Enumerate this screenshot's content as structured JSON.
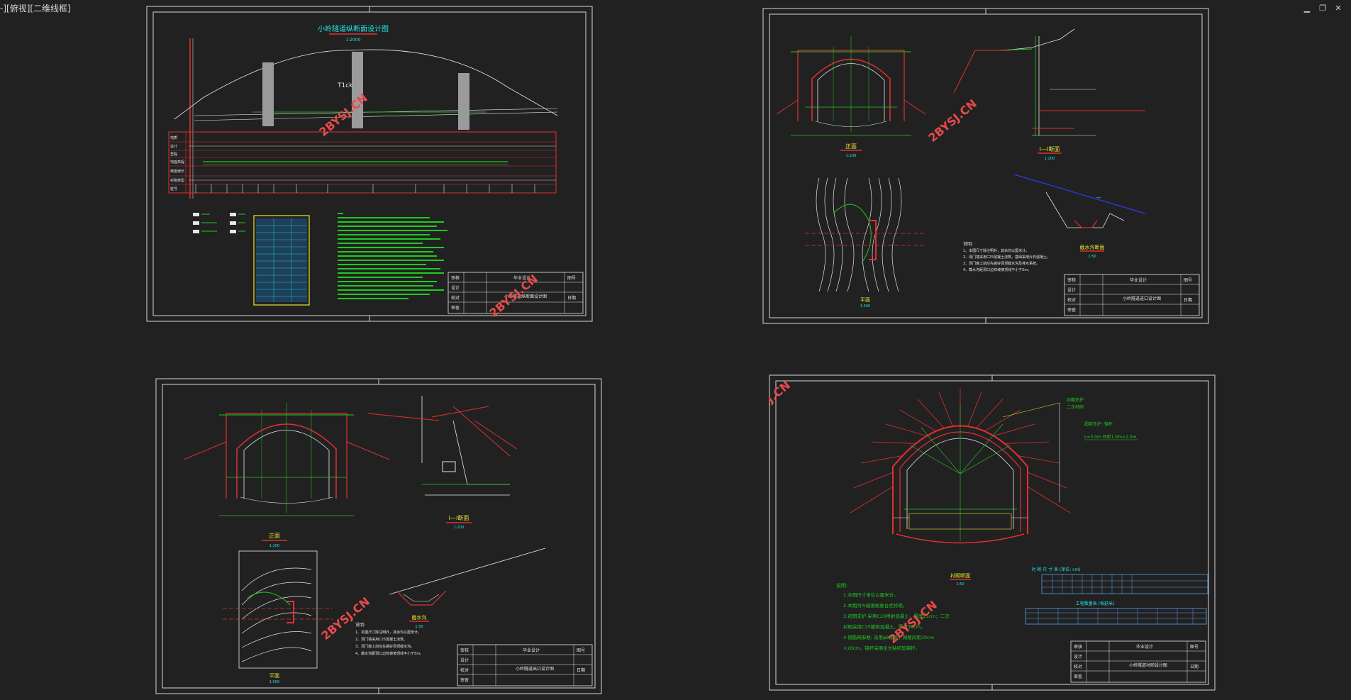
{
  "viewport_label": "-][俯视][二维线框]",
  "window_controls": {
    "minimize": "▁",
    "restore": "❐",
    "close": "✕"
  },
  "watermark": "2BYSJ.CN",
  "sheets": {
    "profile": {
      "title": "小岭隧道纵断面设计图",
      "scale": "1:2000",
      "mark": "T1ck",
      "row_labels": [
        "地质",
        "设计",
        "里程",
        "地面高程",
        "坡度坡长",
        "衬砌类型",
        "桩号"
      ],
      "title_block": {
        "rows": [
          [
            "审核",
            "",
            "",
            "图号"
          ],
          [
            "设计",
            "",
            "",
            ""
          ],
          [
            "校对",
            "",
            "",
            "日期"
          ],
          [
            "审查",
            "",
            "",
            ""
          ]
        ],
        "project": "毕业设计",
        "drawing": "小岭隧道纵断面设计图"
      }
    },
    "portal_in": {
      "view1": "正面",
      "view1_scale": "1:200",
      "view2": "Ⅰ—Ⅰ断面",
      "view2_scale": "1:200",
      "view3": "平面",
      "view3_scale": "1:500",
      "view4": "截水沟断面",
      "view4_scale": "1:50",
      "notes_title": "说明:",
      "notes": [
        "1、本图尺寸除注明外，其余均以厘米计。",
        "2、洞门墙采用C25混凝土浇筑，基础采用片石混凝土。",
        "3、洞门施工前应先做好洞顶截水沟及排水系统。",
        "4、截水沟距洞口边仰坡坡顶线不小于5m。"
      ],
      "title_block": {
        "rows": [
          [
            "审核",
            "",
            "",
            "图号"
          ],
          [
            "设计",
            "",
            "",
            ""
          ],
          [
            "校对",
            "",
            "",
            "日期"
          ],
          [
            "审查",
            "",
            "",
            ""
          ]
        ],
        "project": "毕业设计",
        "drawing": "小岭隧道进口设计图"
      }
    },
    "portal_out": {
      "view1": "正面",
      "view1_scale": "1:200",
      "view2": "Ⅰ—Ⅰ断面",
      "view2_scale": "1:200",
      "view3": "平面",
      "view3_scale": "1:500",
      "view4": "截水沟",
      "view4_scale": "1:50",
      "notes_title": "说明:",
      "notes": [
        "1、本图尺寸除注明外，其余均以厘米计。",
        "2、洞门墙采用C25混凝土浇筑。",
        "3、洞门施工前应先做好洞顶截水沟。",
        "4、截水沟距洞口边仰坡坡顶线不小于5m。"
      ],
      "title_block": {
        "rows": [
          [
            "审核",
            "",
            "",
            "图号"
          ],
          [
            "设计",
            "",
            "",
            ""
          ],
          [
            "校对",
            "",
            "",
            "日期"
          ],
          [
            "审查",
            "",
            "",
            ""
          ]
        ],
        "project": "毕业设计",
        "drawing": "小岭隧道出口设计图"
      }
    },
    "lining": {
      "label_a": "初期支护",
      "label_b": "二次衬砌",
      "label_c": "超前支护: 锚杆",
      "label_d": "L=3.0m 间距1.0m×1.0m",
      "section_label": "衬砌断面",
      "section_scale": "1:50",
      "table1_title": "衬 砌 尺 寸 表 (单位: cm)",
      "table2_title": "工程数量表 (每延米)",
      "notes_title": "说明:",
      "notes": [
        "1.本图尺寸单位以厘米计。",
        "2.本图为Ⅳ级围岩复合式衬砌。",
        "3.初期支护:采用C20喷射混凝土，厚度25cm；二次",
        "衬砌采用C25模筑混凝土，厚度35cm。",
        "4.钢筋网参数: 采用φ8钢筋，网格间距20cm",
        "×20cm。锚杆采用全长粘结型锚杆。"
      ],
      "title_block": {
        "rows": [
          [
            "审核",
            "",
            "",
            "图号"
          ],
          [
            "设计",
            "",
            "",
            ""
          ],
          [
            "校对",
            "",
            "",
            "日期"
          ],
          [
            "审查",
            "",
            "",
            ""
          ]
        ],
        "project": "毕业设计",
        "drawing": "小岭隧道衬砌设计图"
      }
    }
  }
}
